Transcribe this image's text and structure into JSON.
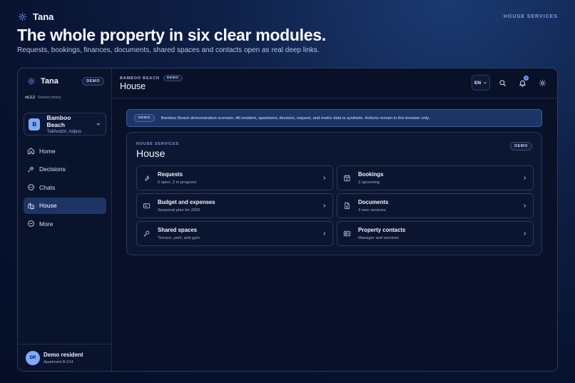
{
  "topbar": {
    "brand": "Tana",
    "section": "HOUSE SERVICES"
  },
  "hero": {
    "title": "The whole property in six clear modules.",
    "subtitle": "Requests, bookings, finances, documents, shared spaces and contacts open as real deep links."
  },
  "sidebar": {
    "brand": "Tana",
    "demo_badge": "DEMO",
    "version": "v0.2.2",
    "version_link": "Version history",
    "property": {
      "initial": "B",
      "name": "Bamboo Beach",
      "location": "Tsikhodziri, Adjara"
    },
    "items": [
      {
        "label": "Home",
        "icon": "home-icon",
        "active": false
      },
      {
        "label": "Decisions",
        "icon": "gavel-icon",
        "active": false
      },
      {
        "label": "Chats",
        "icon": "chat-icon",
        "active": false
      },
      {
        "label": "House",
        "icon": "building-icon",
        "active": true
      },
      {
        "label": "More",
        "icon": "more-icon",
        "active": false
      }
    ],
    "user": {
      "initials": "DR",
      "name": "Demo resident",
      "apartment": "Apartment B-214"
    }
  },
  "header": {
    "breadcrumb": "BAMBOO BEACH",
    "demo_badge": "DEMO",
    "title": "House",
    "language": "EN",
    "notifications_count": "3"
  },
  "banner": {
    "badge": "DEMO",
    "text": "Bamboo Beach demonstration scenario. All resident, apartment, decision, request, and metric data is synthetic. Actions remain in this browser only."
  },
  "panel": {
    "eyebrow": "HOUSE SERVICES",
    "title": "House",
    "badge": "DEMO",
    "cards": [
      {
        "title": "Requests",
        "subtitle": "5 open, 2 in progress",
        "icon": "wrench-icon"
      },
      {
        "title": "Bookings",
        "subtitle": "2 upcoming",
        "icon": "calendar-check-icon"
      },
      {
        "title": "Budget and expenses",
        "subtitle": "Seasonal plan for 2026",
        "icon": "wallet-icon"
      },
      {
        "title": "Documents",
        "subtitle": "3 new versions",
        "icon": "document-icon"
      },
      {
        "title": "Shared spaces",
        "subtitle": "Terrace, pool, and gym",
        "icon": "key-icon"
      },
      {
        "title": "Property contacts",
        "subtitle": "Manager and services",
        "icon": "contact-card-icon"
      }
    ]
  },
  "colors": {
    "accent": "#7ea9ff",
    "active_nav": "#1e3564",
    "banner": "#1b3666",
    "background": "#081128"
  }
}
